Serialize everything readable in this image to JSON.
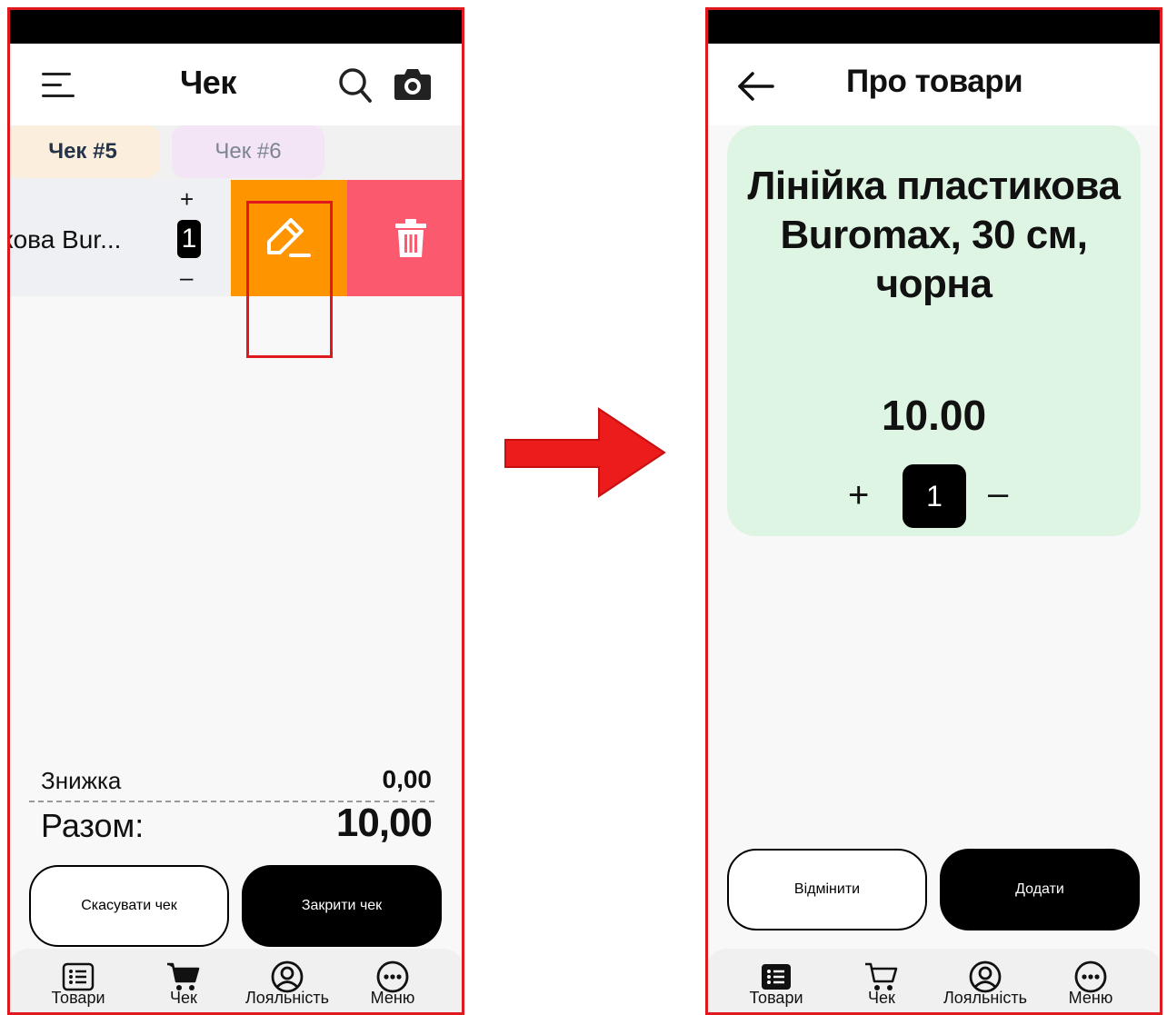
{
  "left_screen": {
    "header": {
      "title": "Чек"
    },
    "tabs": [
      {
        "label": "Чек #5",
        "active": true
      },
      {
        "label": "Чек #6",
        "active": false
      }
    ],
    "item_row": {
      "name": "кова Bur...",
      "plus": "+",
      "quantity": "1",
      "minus": "–",
      "edit_action_icon": "pencil-icon",
      "delete_action_icon": "trash-icon",
      "edit_color": "#fe9500",
      "delete_color": "#fb5a6e"
    },
    "summary": {
      "discount_label": "Знижка",
      "discount_value": "0,00",
      "total_label": "Разом:",
      "total_value": "10,00"
    },
    "buttons": {
      "cancel": "Скасувати чек",
      "close": "Закрити чек"
    }
  },
  "right_screen": {
    "header": {
      "title": "Про товари"
    },
    "product": {
      "name": "Лінійка пластикова Buromax, 30 см, чорна",
      "price": "10.00",
      "plus": "+",
      "quantity": "1",
      "minus": "–",
      "card_color": "#ddf5e2"
    },
    "buttons": {
      "cancel": "Відмінити",
      "add": "Додати"
    }
  },
  "bottom_nav": [
    {
      "label": "Товари",
      "icon": "list-icon"
    },
    {
      "label": "Чек",
      "icon": "cart-icon"
    },
    {
      "label": "Лояльність",
      "icon": "user-circle-icon"
    },
    {
      "label": "Меню",
      "icon": "more-icon"
    }
  ],
  "annotation": {
    "frame_color": "#e0191f"
  }
}
